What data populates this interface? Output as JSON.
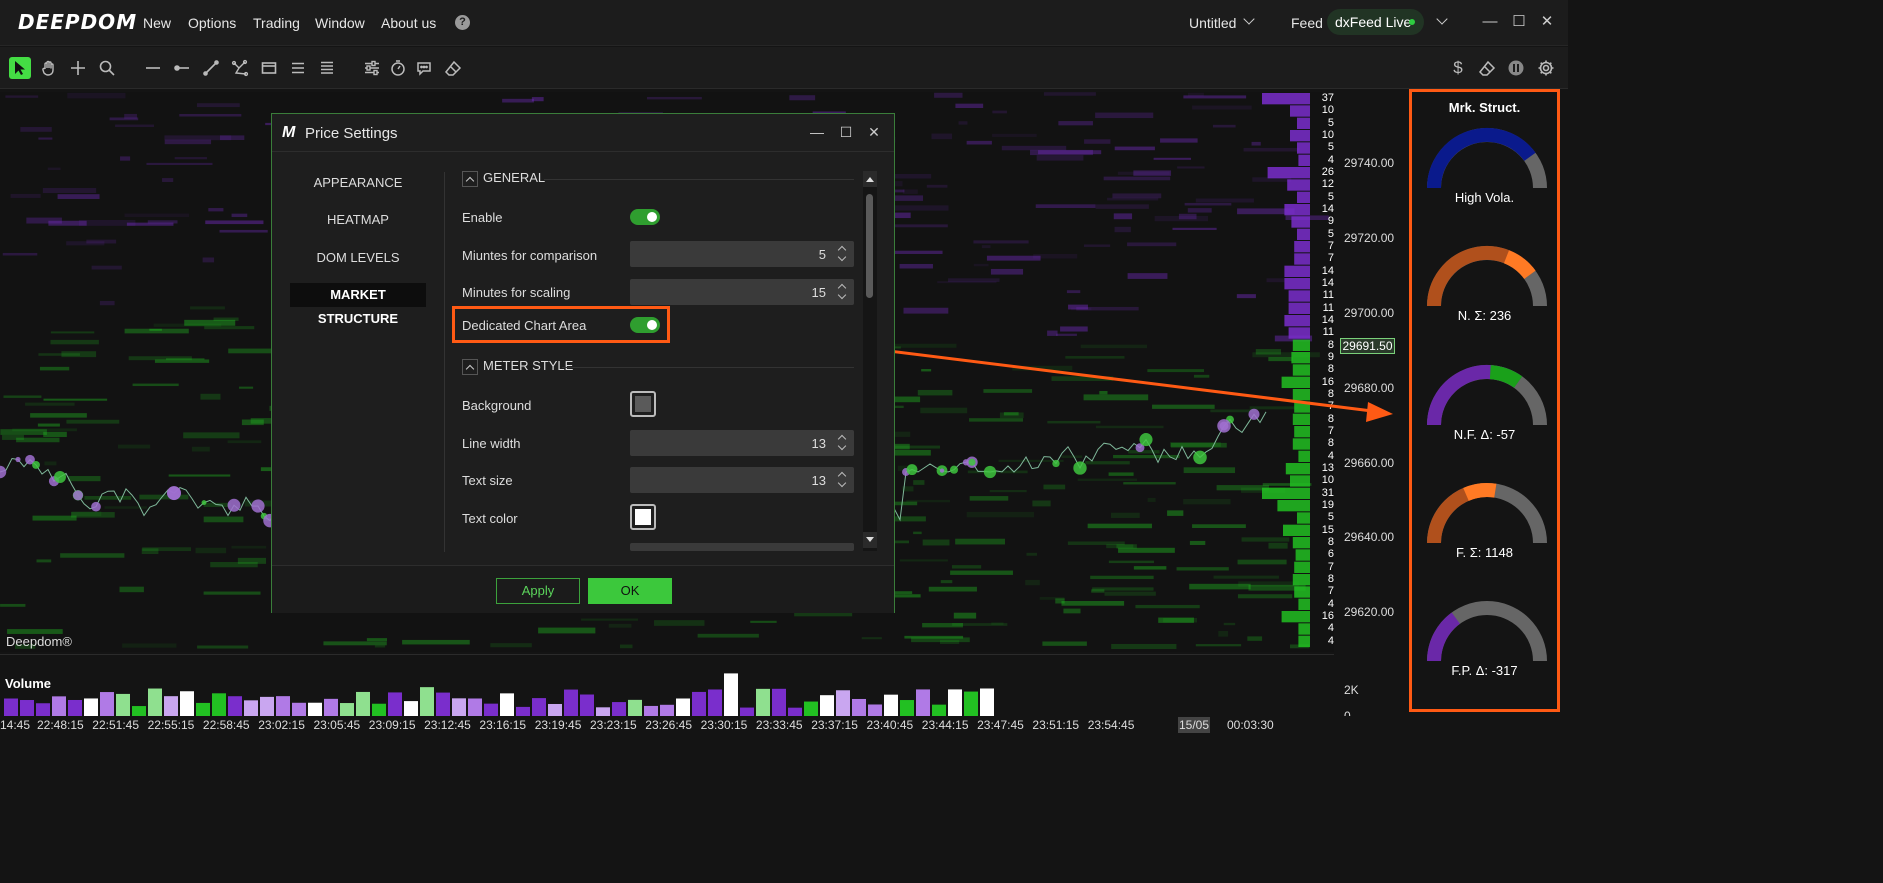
{
  "app": {
    "logo": "DEEPDOM"
  },
  "menu": {
    "items": [
      "New",
      "Options",
      "Trading",
      "Window",
      "About us"
    ],
    "help": "?"
  },
  "workspace": {
    "name": "Untitled"
  },
  "feed": {
    "label": "Feed",
    "source": "dxFeed Live",
    "status_color": "#2ecc40"
  },
  "window_controls": {
    "minimize": "—",
    "maximize": "☐",
    "close": "✕"
  },
  "toolbar": {
    "left_icons": [
      "pointer-icon",
      "hand-icon",
      "crosshair-icon",
      "zoom-icon",
      "horizontal-line-icon",
      "ray-icon",
      "trend-line-icon",
      "polyline-icon",
      "rectangle-icon",
      "list-icon",
      "lines-icon",
      "sliders-icon",
      "timer-icon",
      "comment-icon",
      "eraser-icon"
    ],
    "right_icons": [
      "dollar-icon",
      "eraser-icon",
      "pause-icon",
      "gear-icon"
    ],
    "dollar": "$"
  },
  "chart": {
    "watermark": "Deepdom®",
    "price_labels": [
      "29740.00",
      "29720.00",
      "29700.00",
      "29680.00",
      "29660.00",
      "29640.00",
      "29620.00"
    ],
    "current_price": "29691.50",
    "dom_sizes": [
      "37",
      "10",
      "5",
      "10",
      "5",
      "4",
      "26",
      "12",
      "5",
      "14",
      "9",
      "5",
      "7",
      "7",
      "14",
      "14",
      "11",
      "11",
      "14",
      "11",
      "8",
      "9",
      "8",
      "16",
      "8",
      "7",
      "8",
      "7",
      "8",
      "4",
      "13",
      "10",
      "31",
      "19",
      "5",
      "15",
      "8",
      "6",
      "7",
      "8",
      "7",
      "4",
      "16",
      "4",
      "4"
    ],
    "colors": {
      "ask": "#7a2ecc",
      "bid": "#22c022",
      "current": "#7ad07a"
    }
  },
  "volume": {
    "title": "Volume",
    "axis": [
      "2K",
      "0"
    ]
  },
  "time_axis": {
    "labels": [
      "14:45",
      "22:48:15",
      "22:51:45",
      "22:55:15",
      "22:58:45",
      "23:02:15",
      "23:05:45",
      "23:09:15",
      "23:12:45",
      "23:16:15",
      "23:19:45",
      "23:23:15",
      "23:26:45",
      "23:30:15",
      "23:33:45",
      "23:37:15",
      "23:40:45",
      "23:44:15",
      "23:47:45",
      "23:51:15",
      "23:54:45"
    ],
    "date": "15/05",
    "countdown": "00:03:30"
  },
  "dialog": {
    "logo": "M",
    "title": "Price Settings",
    "controls": {
      "minimize": "—",
      "maximize": "☐",
      "close": "✕"
    },
    "nav": [
      "APPEARANCE",
      "HEATMAP",
      "DOM LEVELS",
      "MARKET STRUCTURE"
    ],
    "nav_active": "MARKET STRUCTURE",
    "sections": {
      "general": "GENERAL",
      "meter_style": "METER STYLE"
    },
    "fields": {
      "enable": "Enable",
      "minutes_comparison": "Miuntes for comparison",
      "minutes_comparison_value": "5",
      "minutes_scaling": "Minutes for scaling",
      "minutes_scaling_value": "15",
      "dedicated_chart_area": "Dedicated Chart Area",
      "background": "Background",
      "background_color": "#5a5a5a",
      "line_width": "Line width",
      "line_width_value": "13",
      "text_size": "Text size",
      "text_size_value": "13",
      "text_color": "Text color",
      "text_color_value": "#ffffff"
    },
    "buttons": {
      "apply": "Apply",
      "ok": "OK"
    }
  },
  "market_structure_panel": {
    "title": "Mrk. Struct.",
    "gauges": [
      {
        "label": "High Vola.",
        "fill_color": "#0a1a8c",
        "value_fraction": 0.8
      },
      {
        "label": "N. Σ: 236",
        "fill_color": "#b0501c",
        "highlight_color": "#ff7a24",
        "value_fraction": 0.8
      },
      {
        "label": "N.F. Δ: -57",
        "fill_color": "#6a28a8",
        "highlight_color": "#1aa01a",
        "value_fraction": 0.7
      },
      {
        "label": "F. Σ: 1148",
        "fill_color": "#b0501c",
        "highlight_color": "#ff7a24",
        "value_fraction": 0.55
      },
      {
        "label": "F.P. Δ: -317",
        "fill_color": "#6a28a8",
        "value_fraction": 0.3
      }
    ],
    "track_color": "#666666",
    "highlight_border": "#ff5a14"
  }
}
